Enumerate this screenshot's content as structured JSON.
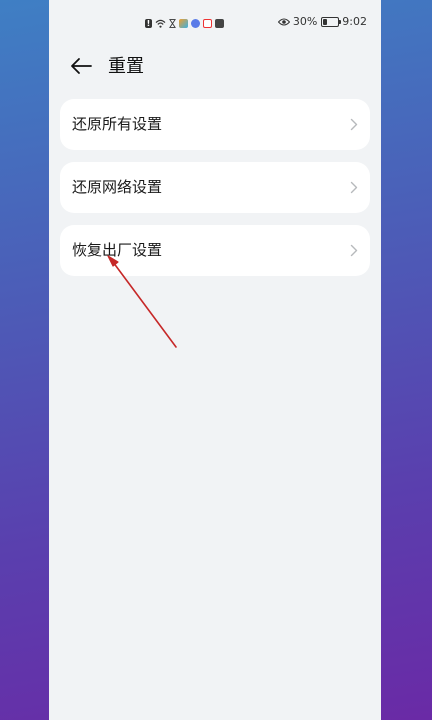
{
  "status_bar": {
    "battery": "30%",
    "time": "9:02",
    "icons": [
      "alert-icon",
      "wifi-icon",
      "hourglass-icon",
      "app-icon",
      "app-icon",
      "app-icon",
      "app-icon",
      "eye-icon",
      "battery-icon"
    ]
  },
  "header": {
    "title": "重置"
  },
  "options": [
    {
      "label": "还原所有设置"
    },
    {
      "label": "还原网络设置"
    },
    {
      "label": "恢复出厂设置"
    }
  ],
  "colors": {
    "annotation_arrow": "#c62828",
    "background_start": "#3f7fc4",
    "background_end": "#6a2aa6"
  }
}
